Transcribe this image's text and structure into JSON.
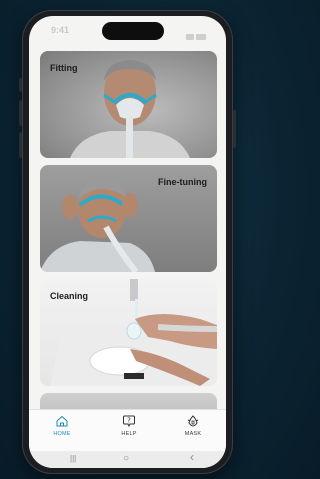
{
  "colors": {
    "accent": "#1f8bb0",
    "mask_blue": "#2fa9c9"
  },
  "status_bar": {
    "time": "9:41"
  },
  "cards": [
    {
      "label": "Fitting"
    },
    {
      "label": "Fine-tuning"
    },
    {
      "label": "Cleaning"
    }
  ],
  "tabs": [
    {
      "label": "HOME",
      "icon": "home-icon",
      "active": true
    },
    {
      "label": "HELP",
      "icon": "help-icon",
      "active": false
    },
    {
      "label": "MASK",
      "icon": "mask-icon",
      "active": false
    }
  ],
  "android_nav": {
    "recents": "|||",
    "home": "○",
    "back": "‹"
  }
}
